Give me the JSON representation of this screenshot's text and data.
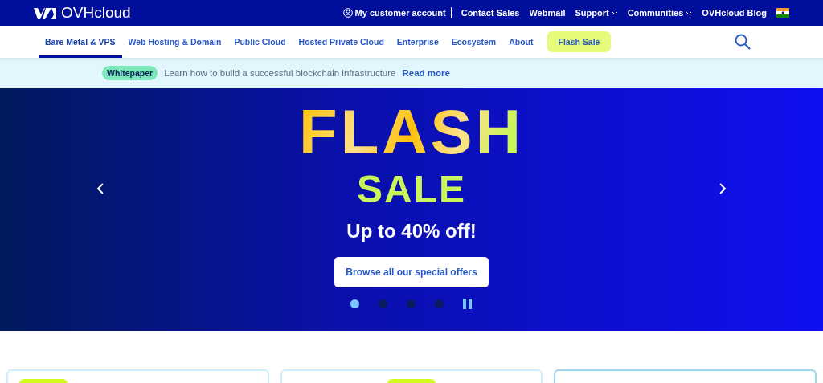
{
  "brand": {
    "name": "OVHcloud"
  },
  "top_links": [
    {
      "label": "My customer account",
      "kind": "account"
    },
    {
      "label": "Contact Sales",
      "kind": "link"
    },
    {
      "label": "Webmail",
      "kind": "link"
    },
    {
      "label": "Support",
      "kind": "dropdown"
    },
    {
      "label": "Communities",
      "kind": "dropdown"
    },
    {
      "label": "OVHcloud Blog",
      "kind": "link"
    },
    {
      "kind": "flag"
    }
  ],
  "nav": [
    {
      "label": "Bare Metal & VPS",
      "selected": true,
      "kind": "link"
    },
    {
      "label": "Web Hosting & Domain",
      "selected": false,
      "kind": "link"
    },
    {
      "label": "Public Cloud",
      "selected": false,
      "kind": "link"
    },
    {
      "label": "Hosted Private Cloud",
      "selected": false,
      "kind": "link"
    },
    {
      "label": "Enterprise",
      "selected": false,
      "kind": "link"
    },
    {
      "label": "Ecosystem",
      "selected": false,
      "kind": "link"
    },
    {
      "label": "About",
      "selected": false,
      "kind": "link"
    },
    {
      "label": "Flash Sale",
      "selected": false,
      "kind": "highlight"
    }
  ],
  "promo": {
    "tag": "Whitepaper",
    "text": "Learn how to build a successful blockchain infrastructure",
    "link": "Read more"
  },
  "hero": {
    "title": "FLASH",
    "subtitle": "SALE",
    "offer": "Up to 40% off!",
    "button": "Browse all our special offers",
    "slides": [
      {
        "selected": true
      },
      {
        "selected": false
      },
      {
        "selected": false
      },
      {
        "selected": false
      }
    ]
  },
  "cards": [
    {
      "kind": "left",
      "selected": false
    },
    {
      "kind": "center",
      "selected": false
    },
    {
      "kind": "plain",
      "selected": true
    }
  ]
}
